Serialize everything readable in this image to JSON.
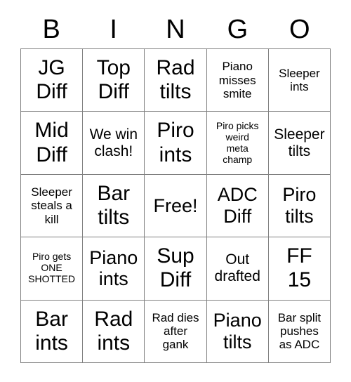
{
  "card": {
    "title_letters": [
      "B",
      "I",
      "N",
      "G",
      "O"
    ],
    "rows": [
      [
        {
          "text": "JG\nDiff",
          "size": "xl"
        },
        {
          "text": "Top\nDiff",
          "size": "xl"
        },
        {
          "text": "Rad\ntilts",
          "size": "xl"
        },
        {
          "text": "Piano\nmisses\nsmite",
          "size": "sm"
        },
        {
          "text": "Sleeper\nints",
          "size": "sm"
        }
      ],
      [
        {
          "text": "Mid\nDiff",
          "size": "xl"
        },
        {
          "text": "We win\nclash!",
          "size": "md"
        },
        {
          "text": "Piro\nints",
          "size": "xl"
        },
        {
          "text": "Piro picks\nweird\nmeta\nchamp",
          "size": "xs"
        },
        {
          "text": "Sleeper\ntilts",
          "size": "md"
        }
      ],
      [
        {
          "text": "Sleeper\nsteals a\nkill",
          "size": "sm"
        },
        {
          "text": "Bar\ntilts",
          "size": "xl"
        },
        {
          "text": "Free!",
          "size": "lg"
        },
        {
          "text": "ADC\nDiff",
          "size": "lg"
        },
        {
          "text": "Piro\ntilts",
          "size": "lg"
        }
      ],
      [
        {
          "text": "Piro gets\nONE\nSHOTTED",
          "size": "xs"
        },
        {
          "text": "Piano\nints",
          "size": "lg"
        },
        {
          "text": "Sup\nDiff",
          "size": "xl"
        },
        {
          "text": "Out\ndrafted",
          "size": "md"
        },
        {
          "text": "FF\n15",
          "size": "xl"
        }
      ],
      [
        {
          "text": "Bar\nints",
          "size": "xl"
        },
        {
          "text": "Rad\nints",
          "size": "xl"
        },
        {
          "text": "Rad dies\nafter\ngank",
          "size": "sm"
        },
        {
          "text": "Piano\ntilts",
          "size": "lg"
        },
        {
          "text": "Bar split\npushes\nas ADC",
          "size": "sm"
        }
      ]
    ],
    "colors": {
      "background": "#ffffff",
      "text": "#000000",
      "border": "#808080"
    }
  }
}
